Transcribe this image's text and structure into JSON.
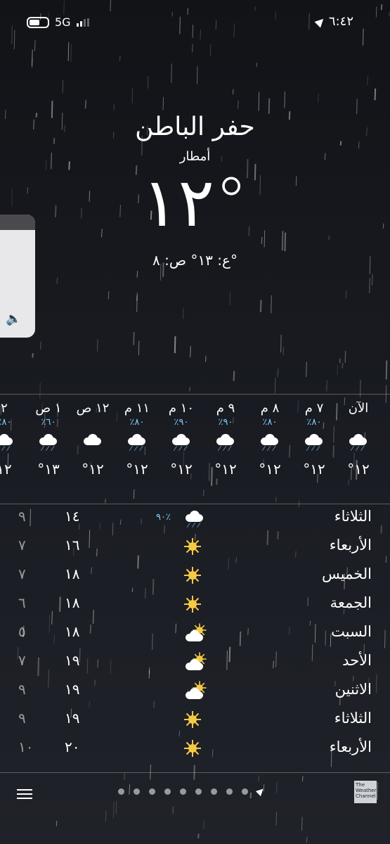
{
  "status": {
    "carrier": "5G",
    "time": "٦:٤٢"
  },
  "location": {
    "city": "حفر الباطن",
    "condition": "أمطار",
    "temperature": "١٢°",
    "hilo": "ع: ١٣° ص: ٨°"
  },
  "hourly": [
    {
      "time": "الآن",
      "precip": "",
      "icon": "rain-cloud-icon",
      "temp": "١٢°"
    },
    {
      "time": "٧ م",
      "precip": "٨٠٪",
      "icon": "rain-cloud-icon",
      "temp": "١٢°"
    },
    {
      "time": "٨ م",
      "precip": "٨٠٪",
      "icon": "rain-cloud-icon",
      "temp": "١٢°"
    },
    {
      "time": "٩ م",
      "precip": "٩٠٪",
      "icon": "rain-cloud-icon",
      "temp": "١٢°"
    },
    {
      "time": "١٠ م",
      "precip": "٩٠٪",
      "icon": "rain-cloud-icon",
      "temp": "١٢°"
    },
    {
      "time": "١١ م",
      "precip": "٨٠٪",
      "icon": "rain-cloud-icon",
      "temp": "١٢°"
    },
    {
      "time": "١٢ ص",
      "precip": "",
      "icon": "cloud-icon",
      "temp": "١٢°"
    },
    {
      "time": "١ ص",
      "precip": "٦٠٪",
      "icon": "rain-cloud-icon",
      "temp": "١٣°"
    },
    {
      "time": "٢",
      "precip": "٨٠٪",
      "icon": "rain-cloud-icon",
      "temp": "١٢"
    }
  ],
  "daily": [
    {
      "day": "الثلاثاء",
      "icon": "rain-cloud-icon",
      "precip": "٩٠٪",
      "high": "١٤",
      "low": "٩"
    },
    {
      "day": "الأربعاء",
      "icon": "sun-icon",
      "precip": "",
      "high": "١٦",
      "low": "٧"
    },
    {
      "day": "الخميس",
      "icon": "sun-icon",
      "precip": "",
      "high": "١٨",
      "low": "٧"
    },
    {
      "day": "الجمعة",
      "icon": "sun-icon",
      "precip": "",
      "high": "١٨",
      "low": "٦"
    },
    {
      "day": "السبت",
      "icon": "partly-cloudy-icon",
      "precip": "",
      "high": "١٨",
      "low": "٥"
    },
    {
      "day": "الأحد",
      "icon": "partly-cloudy-icon",
      "precip": "",
      "high": "١٩",
      "low": "٧"
    },
    {
      "day": "الاثنين",
      "icon": "partly-cloudy-icon",
      "precip": "",
      "high": "١٩",
      "low": "٩"
    },
    {
      "day": "الثلاثاء",
      "icon": "sun-icon",
      "precip": "",
      "high": "١٩",
      "low": "٩"
    },
    {
      "day": "الأربعاء",
      "icon": "sun-icon",
      "precip": "",
      "high": "٢٠",
      "low": "١٠"
    }
  ],
  "footer": {
    "brand_text": "The Weather Channel",
    "page_count": 9
  },
  "colors": {
    "accent_precip": "#7fd0ff",
    "sun": "#f6c944"
  }
}
